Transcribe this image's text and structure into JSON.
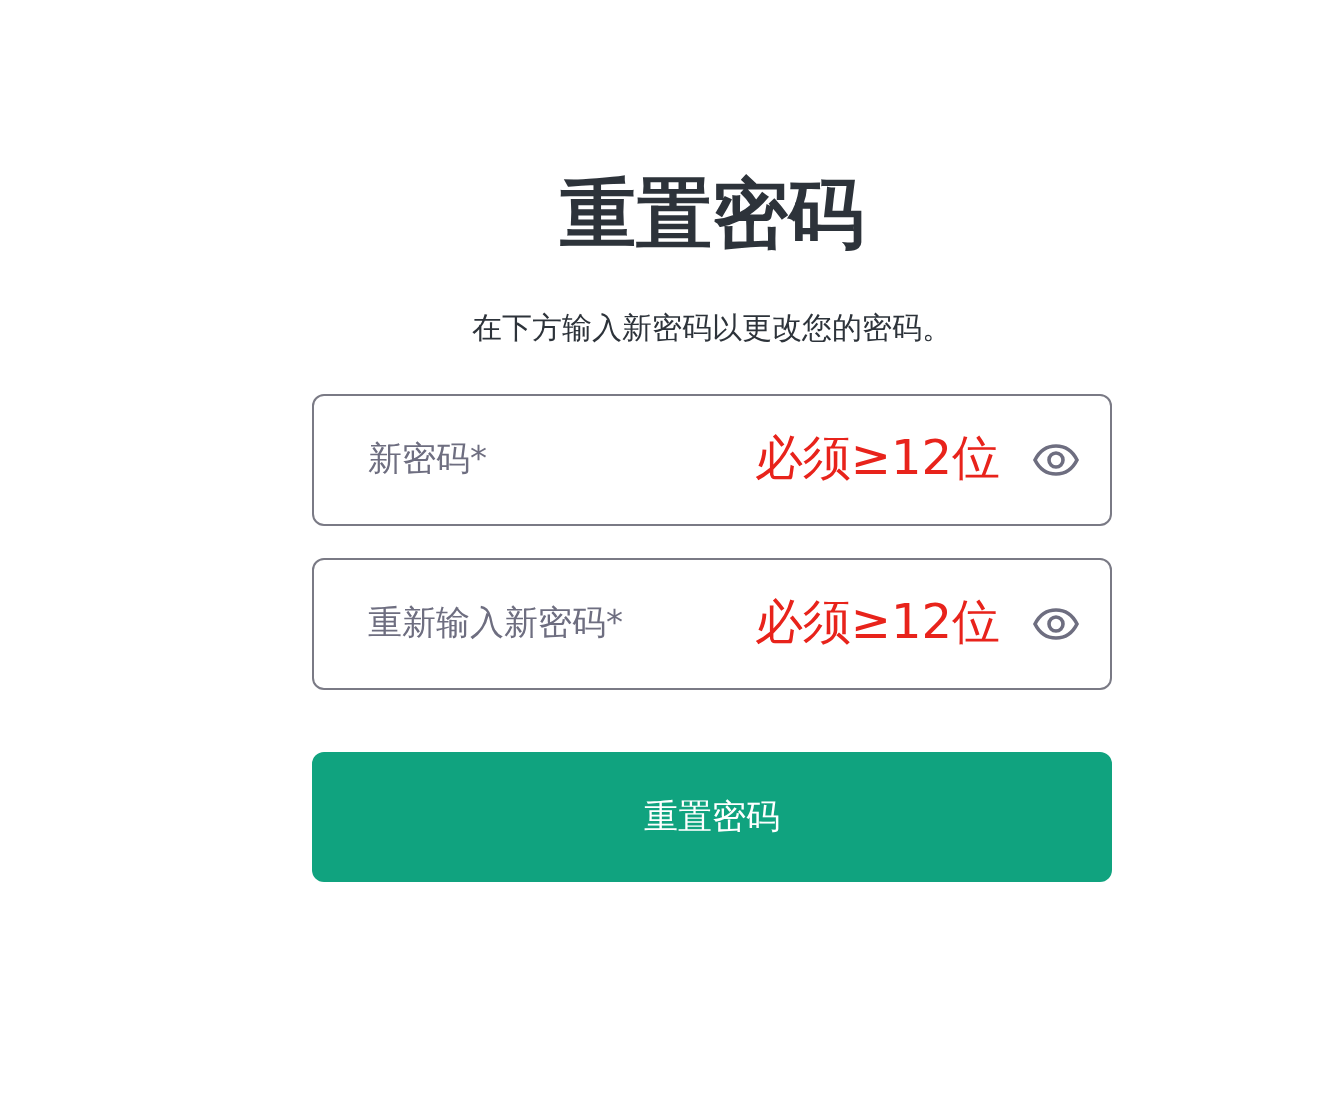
{
  "title": "重置密码",
  "subtitle": "在下方输入新密码以更改您的密码。",
  "fields": [
    {
      "placeholder": "新密码*",
      "note": "必须≥12位"
    },
    {
      "placeholder": "重新输入新密码*",
      "note": "必须≥12位"
    }
  ],
  "button": "重置密码"
}
